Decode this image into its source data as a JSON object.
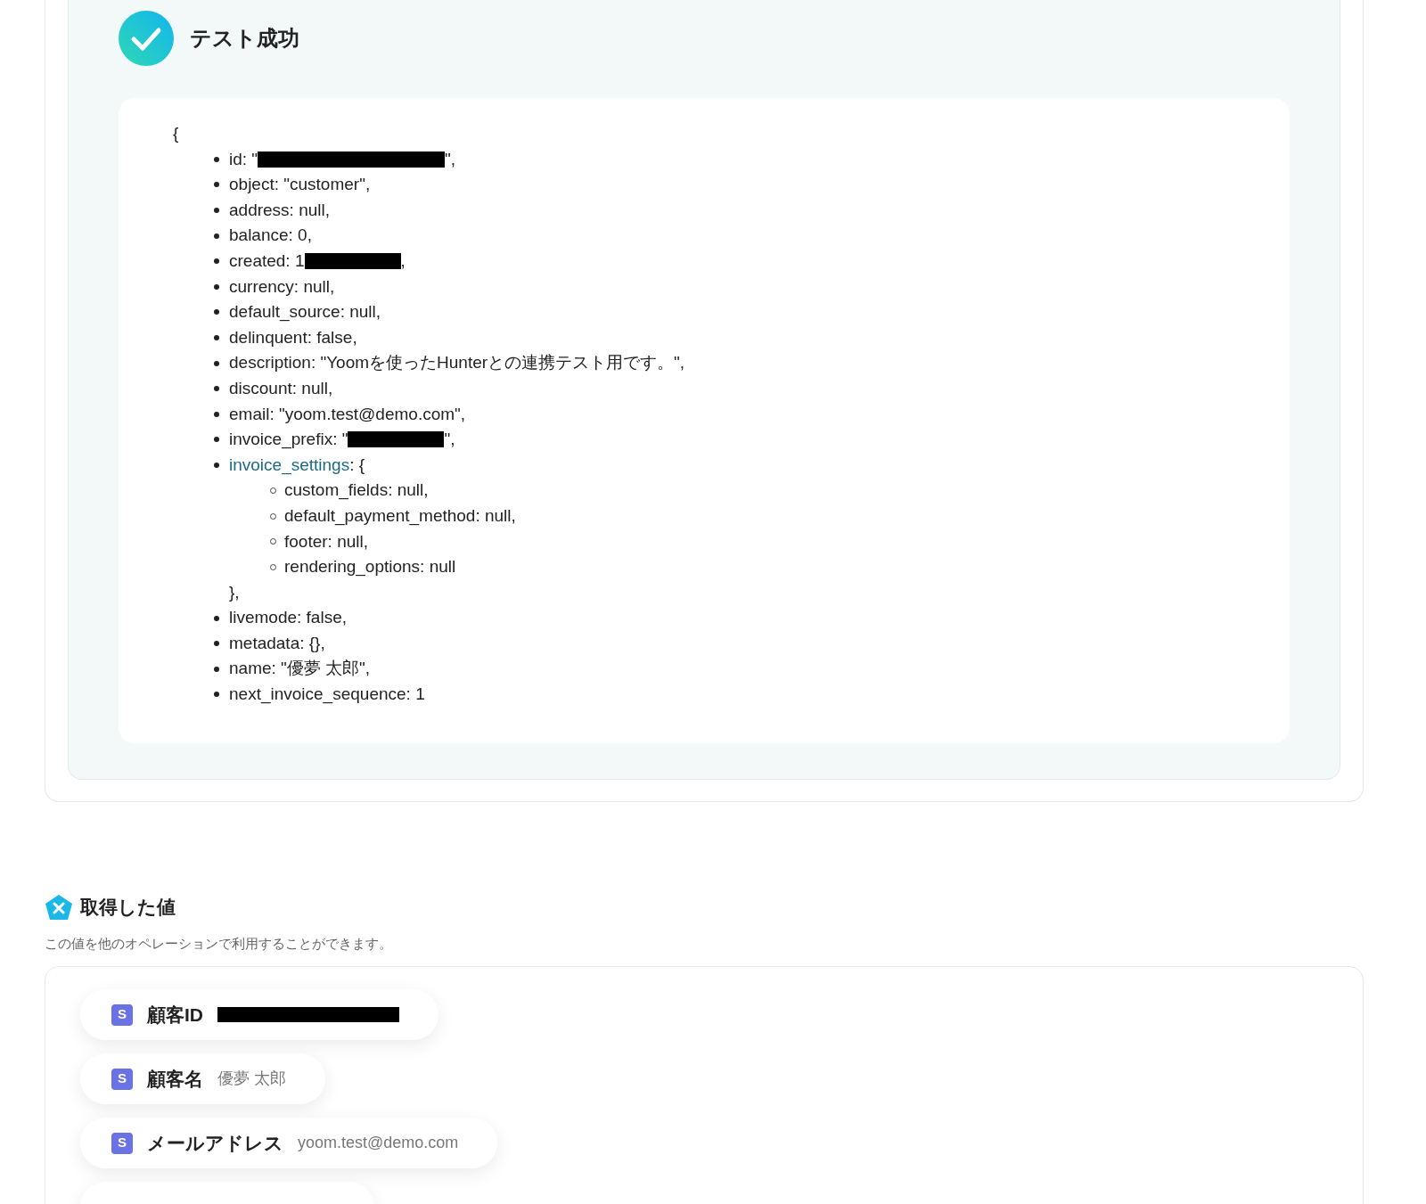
{
  "test_result": {
    "title": "テスト成功",
    "code": {
      "open": "{",
      "items": [
        {
          "parts": [
            {
              "text": "id: \""
            },
            {
              "kind": "redaction_long"
            },
            {
              "text": "\","
            }
          ]
        },
        {
          "parts": [
            {
              "text": "object: \"customer\","
            }
          ]
        },
        {
          "parts": [
            {
              "text": "address: null,"
            }
          ]
        },
        {
          "parts": [
            {
              "text": "balance: 0,"
            }
          ]
        },
        {
          "parts": [
            {
              "text": "created: 1"
            },
            {
              "kind": "redaction_short"
            },
            {
              "text": ","
            }
          ]
        },
        {
          "parts": [
            {
              "text": "currency: null,"
            }
          ]
        },
        {
          "parts": [
            {
              "text": "default_source: null,"
            }
          ]
        },
        {
          "parts": [
            {
              "text": "delinquent: false,"
            }
          ]
        },
        {
          "parts": [
            {
              "text": "description: \"Yoomを使ったHunterとの連携テスト用です。\","
            }
          ]
        },
        {
          "parts": [
            {
              "text": "discount: null,"
            }
          ]
        },
        {
          "parts": [
            {
              "text": "email: \"yoom.test@demo.com\","
            }
          ]
        },
        {
          "parts": [
            {
              "text": "invoice_prefix: \""
            },
            {
              "kind": "redaction_short"
            },
            {
              "text": "\","
            }
          ]
        },
        {
          "parts": [
            {
              "kind": "link",
              "text": "invoice_settings"
            },
            {
              "text": ": {"
            }
          ],
          "children": [
            "custom_fields: null,",
            "default_payment_method: null,",
            "footer: null,",
            "rendering_options: null"
          ],
          "close": "},"
        },
        {
          "parts": [
            {
              "text": "livemode: false,"
            }
          ]
        },
        {
          "parts": [
            {
              "text": "metadata: {},"
            }
          ]
        },
        {
          "parts": [
            {
              "text": "name: \"優夢 太郎\","
            }
          ]
        },
        {
          "parts": [
            {
              "text": "next_invoice_sequence: 1"
            }
          ]
        }
      ]
    }
  },
  "values": {
    "title": "取得した値",
    "subtitle": "この値を他のオペレーションで利用することができます。",
    "fields": [
      {
        "kind": "field",
        "icon": "S",
        "label": "顧客ID",
        "redacted": true
      },
      {
        "kind": "field",
        "icon": "S",
        "label": "顧客名",
        "value": "優夢 太郎",
        "redacted": false
      },
      {
        "kind": "field",
        "icon": "S",
        "label": "メールアドレス",
        "value": "yoom.test@demo.com",
        "redacted": false
      },
      {
        "kind": "cut_off"
      }
    ]
  }
}
